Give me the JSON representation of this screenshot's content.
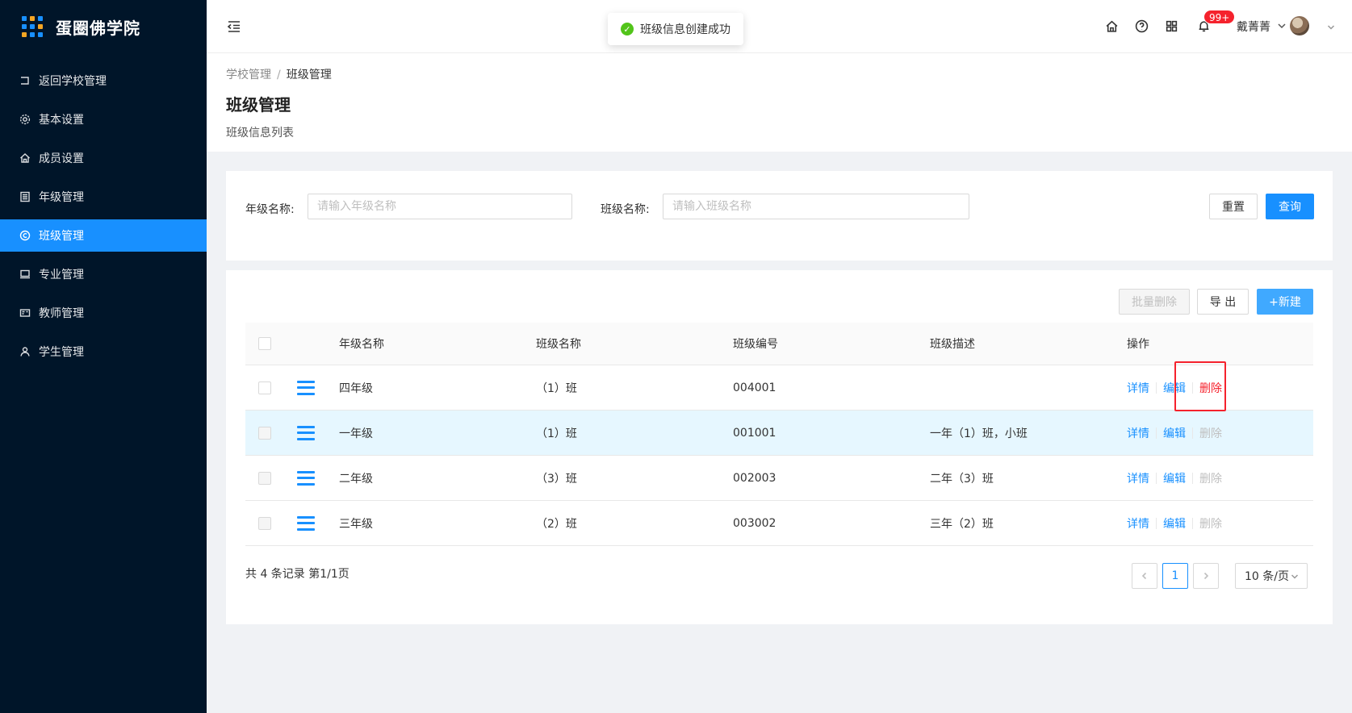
{
  "app": {
    "title": "蛋圈佛学院"
  },
  "sidebar": {
    "items": [
      {
        "label": "返回学校管理",
        "icon": "return-icon"
      },
      {
        "label": "基本设置",
        "icon": "gear-icon"
      },
      {
        "label": "成员设置",
        "icon": "home-icon"
      },
      {
        "label": "年级管理",
        "icon": "list-icon"
      },
      {
        "label": "班级管理",
        "icon": "copyright-icon",
        "active": true
      },
      {
        "label": "专业管理",
        "icon": "laptop-icon"
      },
      {
        "label": "教师管理",
        "icon": "idcard-icon"
      },
      {
        "label": "学生管理",
        "icon": "user-icon"
      }
    ]
  },
  "header": {
    "toast": "班级信息创建成功",
    "badge": "99+",
    "user_name": "戴菁菁"
  },
  "page": {
    "breadcrumb": [
      "学校管理",
      "/",
      "班级管理"
    ],
    "title": "班级管理",
    "description": "班级信息列表"
  },
  "search": {
    "grade_label": "年级名称:",
    "grade_placeholder": "请输入年级名称",
    "class_label": "班级名称:",
    "class_placeholder": "请输入班级名称",
    "reset": "重置",
    "query": "查询"
  },
  "toolbar": {
    "batch_delete": "批量删除",
    "export": "导 出",
    "create": "+新建"
  },
  "table": {
    "columns": [
      "年级名称",
      "班级名称",
      "班级编号",
      "班级描述",
      "操作"
    ],
    "rows": [
      {
        "grade": "四年级",
        "class": "（1）班",
        "code": "004001",
        "desc": ""
      },
      {
        "grade": "一年级",
        "class": "（1）班",
        "code": "001001",
        "desc": "一年（1）班，小班"
      },
      {
        "grade": "二年级",
        "class": "（3）班",
        "code": "002003",
        "desc": "二年（3）班"
      },
      {
        "grade": "三年级",
        "class": "（2）班",
        "code": "003002",
        "desc": "三年（2）班"
      }
    ],
    "actions": {
      "detail": "详情",
      "edit": "编辑",
      "delete": "删除"
    }
  },
  "pagination": {
    "total": "共 4 条记录 第1/1页",
    "current": "1",
    "page_size": "10 条/页"
  },
  "colors": {
    "primary": "#1890ff",
    "danger": "#f5222d",
    "sidebar": "#001529"
  }
}
